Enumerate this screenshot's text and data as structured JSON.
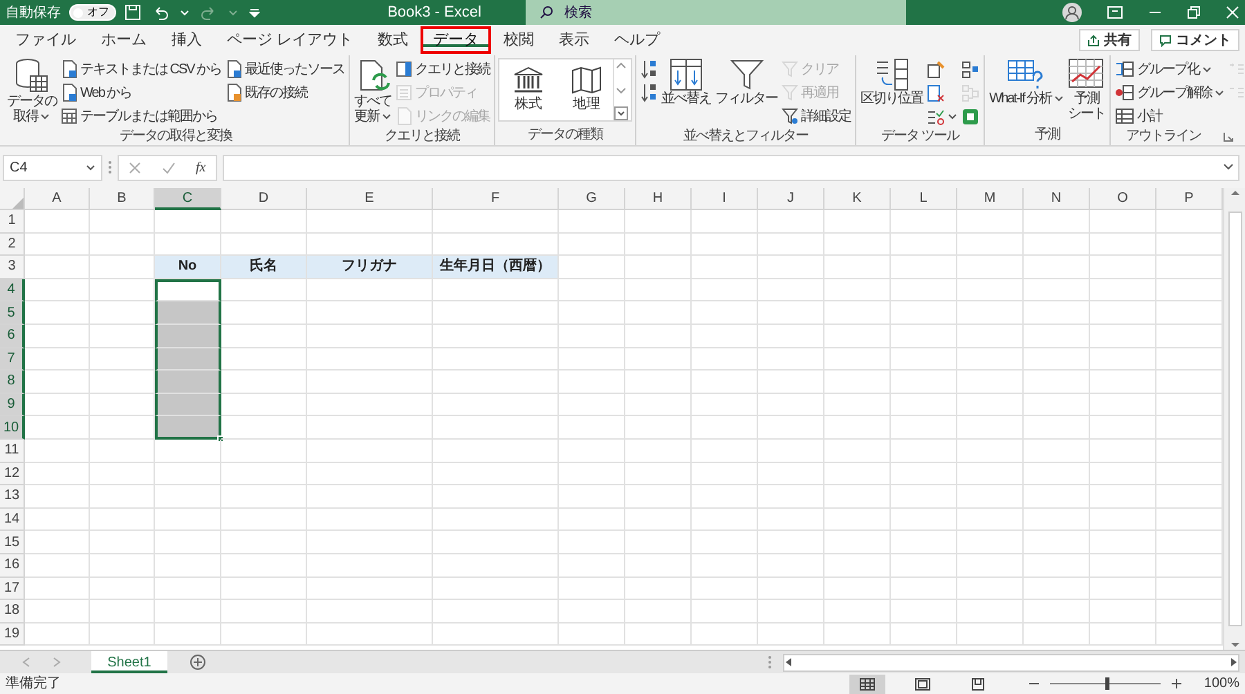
{
  "title_bar": {
    "autosave_label": "自動保存",
    "autosave_toggle": {
      "label": "オフ",
      "on": false
    },
    "title": "Book3 - Excel",
    "search": {
      "placeholder": "検索"
    }
  },
  "tabs": [
    {
      "label": "ファイル",
      "selected": false
    },
    {
      "label": "ホーム",
      "selected": false
    },
    {
      "label": "挿入",
      "selected": false
    },
    {
      "label": "ページ レイアウト",
      "selected": false
    },
    {
      "label": "数式",
      "selected": false
    },
    {
      "label": "データ",
      "selected": true
    },
    {
      "label": "校閲",
      "selected": false
    },
    {
      "label": "表示",
      "selected": false
    },
    {
      "label": "ヘルプ",
      "selected": false
    }
  ],
  "share_button": "共有",
  "comment_button": "コメント",
  "ribbon": {
    "groups": [
      {
        "label": "データの取得と変換",
        "columns": [
          [
            {
              "kind": "large",
              "label_lines": [
                "データの",
                "取得"
              ],
              "dropdown": true,
              "disabled": false
            }
          ],
          [
            {
              "kind": "small",
              "label": "テキストまたは CSV から",
              "dropdown": false,
              "disabled": false
            },
            {
              "kind": "small",
              "label": "Web から",
              "dropdown": false,
              "disabled": false
            },
            {
              "kind": "small",
              "label": "テーブルまたは範囲から",
              "dropdown": false,
              "disabled": false
            }
          ],
          [
            {
              "kind": "small",
              "label": "最近使ったソース",
              "dropdown": false,
              "disabled": false
            },
            {
              "kind": "small",
              "label": "既存の接続",
              "dropdown": false,
              "disabled": false
            }
          ]
        ]
      },
      {
        "label": "クエリと接続",
        "columns": [
          [
            {
              "kind": "large",
              "label_lines": [
                "すべて",
                "更新"
              ],
              "dropdown": true,
              "disabled": false
            }
          ],
          [
            {
              "kind": "small",
              "label": "クエリと接続",
              "dropdown": false,
              "disabled": false
            },
            {
              "kind": "small",
              "label": "プロパティ",
              "dropdown": false,
              "disabled": true
            },
            {
              "kind": "small",
              "label": "リンクの編集",
              "dropdown": false,
              "disabled": true
            }
          ]
        ]
      },
      {
        "label": "データの種類",
        "columns": [
          [
            {
              "kind": "gallery",
              "label": "株式",
              "disabled": false
            }
          ],
          [
            {
              "kind": "gallery",
              "label": "地理",
              "disabled": false
            }
          ]
        ]
      },
      {
        "label": "並べ替えとフィルター",
        "columns": [
          [
            {
              "kind": "icon",
              "dropdown": false,
              "disabled": false
            },
            {
              "kind": "icon",
              "dropdown": false,
              "disabled": false
            }
          ],
          [
            {
              "kind": "large",
              "label_lines": [
                "並べ替え"
              ],
              "dropdown": false,
              "disabled": false
            }
          ],
          [
            {
              "kind": "large",
              "label_lines": [
                "フィルター"
              ],
              "dropdown": false,
              "disabled": false
            }
          ],
          [
            {
              "kind": "small",
              "label": "クリア",
              "dropdown": false,
              "disabled": true
            },
            {
              "kind": "small",
              "label": "再適用",
              "dropdown": false,
              "disabled": true
            },
            {
              "kind": "small",
              "label": "詳細設定",
              "dropdown": false,
              "disabled": false
            }
          ]
        ]
      },
      {
        "label": "データ ツール",
        "columns": [
          [
            {
              "kind": "large",
              "label_lines": [
                "区切り位置"
              ],
              "dropdown": false,
              "disabled": false
            }
          ],
          [
            {
              "kind": "icon",
              "dropdown": false,
              "disabled": false
            },
            {
              "kind": "icon",
              "dropdown": false,
              "disabled": false
            },
            {
              "kind": "icon",
              "dropdown": true,
              "disabled": false
            }
          ],
          [
            {
              "kind": "icon",
              "dropdown": false,
              "disabled": false
            },
            {
              "kind": "icon",
              "dropdown": false,
              "disabled": true
            },
            {
              "kind": "icon",
              "dropdown": false,
              "disabled": false
            }
          ]
        ]
      },
      {
        "label": "予測",
        "columns": [
          [
            {
              "kind": "large",
              "label_lines": [
                "What-If 分析"
              ],
              "dropdown": true,
              "disabled": false
            }
          ],
          [
            {
              "kind": "large",
              "label_lines": [
                "予測",
                "シート"
              ],
              "dropdown": false,
              "disabled": false
            }
          ]
        ]
      },
      {
        "label": "アウトライン",
        "columns": [
          [
            {
              "kind": "small",
              "label": "グループ化",
              "dropdown": true,
              "disabled": false
            },
            {
              "kind": "small",
              "label": "グループ解除",
              "dropdown": true,
              "disabled": false
            },
            {
              "kind": "small",
              "label": "小計",
              "dropdown": false,
              "disabled": false
            }
          ],
          [
            {
              "kind": "icon",
              "dropdown": false,
              "disabled": true
            },
            {
              "kind": "icon",
              "dropdown": false,
              "disabled": true
            }
          ]
        ]
      }
    ]
  },
  "formula_bar": {
    "name_box": "C4",
    "function_label": "fx"
  },
  "sheet": {
    "columns": [
      {
        "label": "A",
        "selected": false
      },
      {
        "label": "B",
        "selected": false
      },
      {
        "label": "C",
        "selected": true
      },
      {
        "label": "D",
        "selected": false
      },
      {
        "label": "E",
        "selected": false
      },
      {
        "label": "F",
        "selected": false
      },
      {
        "label": "G",
        "selected": false
      },
      {
        "label": "H",
        "selected": false
      },
      {
        "label": "I",
        "selected": false
      },
      {
        "label": "J",
        "selected": false
      },
      {
        "label": "K",
        "selected": false
      },
      {
        "label": "L",
        "selected": false
      },
      {
        "label": "M",
        "selected": false
      },
      {
        "label": "N",
        "selected": false
      },
      {
        "label": "O",
        "selected": false
      },
      {
        "label": "P",
        "selected": false
      }
    ],
    "rows": [
      {
        "label": "1",
        "selected": false
      },
      {
        "label": "2",
        "selected": false
      },
      {
        "label": "3",
        "selected": false,
        "cells": [
          null,
          null,
          {
            "text": "No"
          },
          {
            "text": "氏名"
          },
          {
            "text": "フリガナ"
          },
          {
            "text": "生年月日（西暦）"
          }
        ]
      },
      {
        "label": "4",
        "selected": true
      },
      {
        "label": "5",
        "selected": true
      },
      {
        "label": "6",
        "selected": true
      },
      {
        "label": "7",
        "selected": true
      },
      {
        "label": "8",
        "selected": true
      },
      {
        "label": "9",
        "selected": true
      },
      {
        "label": "10",
        "selected": true
      },
      {
        "label": "11",
        "selected": false
      },
      {
        "label": "12",
        "selected": false
      },
      {
        "label": "13",
        "selected": false
      },
      {
        "label": "14",
        "selected": false
      },
      {
        "label": "15",
        "selected": false
      },
      {
        "label": "16",
        "selected": false
      },
      {
        "label": "17",
        "selected": false
      },
      {
        "label": "18",
        "selected": false
      },
      {
        "label": "19",
        "selected": false
      }
    ]
  },
  "sheet_tabs": [
    {
      "label": "Sheet1",
      "selected": true
    }
  ],
  "status_bar": {
    "status": "準備完了",
    "views": [
      {
        "kind": "normal",
        "selected": true
      },
      {
        "kind": "page_layout",
        "selected": false
      },
      {
        "kind": "page_break",
        "selected": false
      }
    ],
    "zoom": {
      "level": 0.5,
      "reading": "100%"
    }
  }
}
